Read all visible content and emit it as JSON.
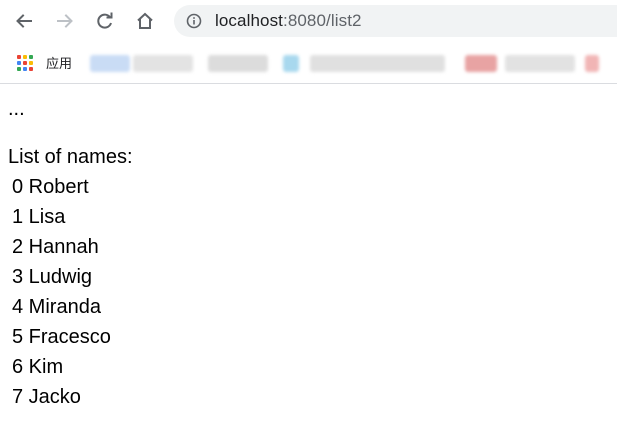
{
  "browser": {
    "url_host": "localhost",
    "url_rest": ":8080/list2",
    "apps_label": "应用",
    "apps_colors": [
      "#ea4335",
      "#fbbc05",
      "#34a853",
      "#4285f4",
      "#ea4335",
      "#fbbc05",
      "#34a853",
      "#4285f4",
      "#ea4335"
    ]
  },
  "page": {
    "ellipsis": "...",
    "heading": "List of names:",
    "names": [
      "0 Robert",
      "1 Lisa",
      "2 Hannah",
      "3 Ludwig",
      "4 Miranda",
      "5 Fracesco",
      "6 Kim",
      "7 Jacko"
    ]
  }
}
